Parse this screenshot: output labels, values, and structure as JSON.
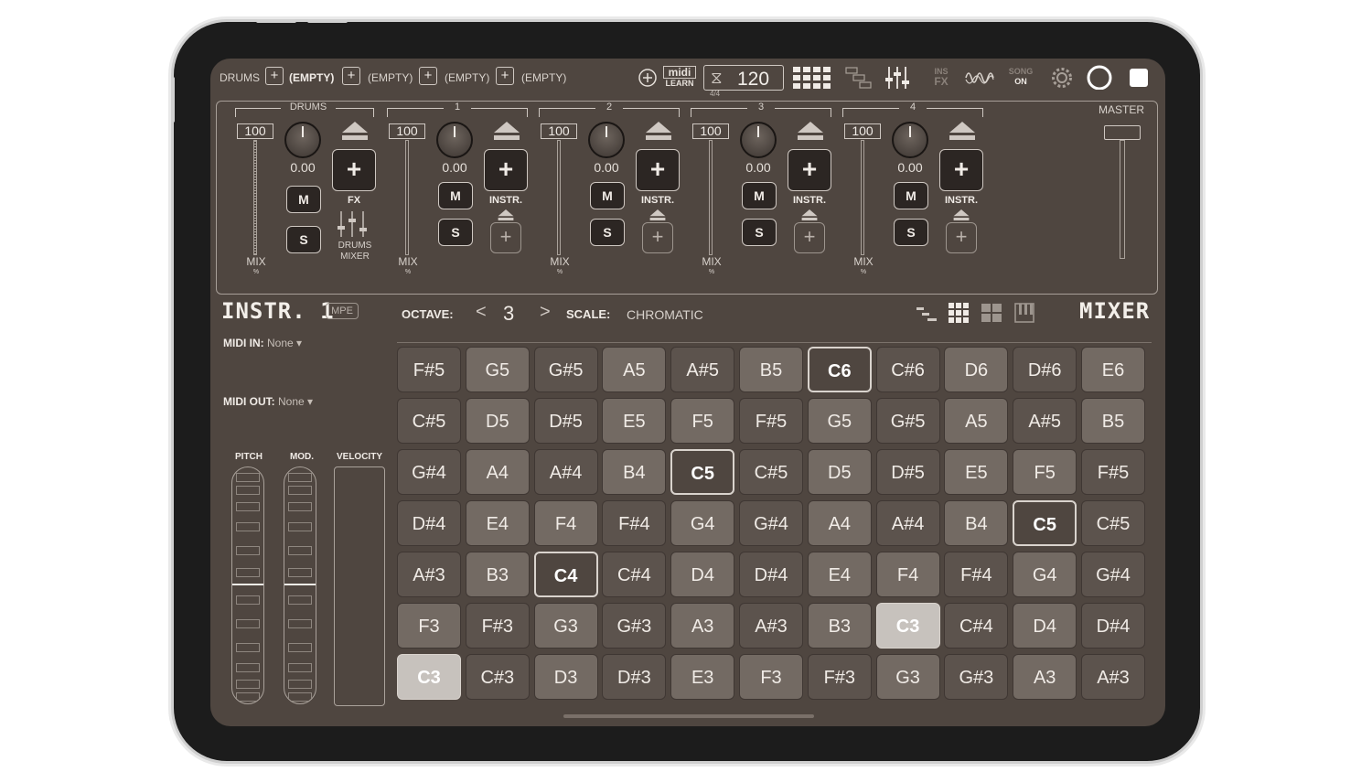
{
  "topbar": {
    "slots": [
      {
        "label": "DRUMS",
        "bold": false
      },
      {
        "label": "(EMPTY)",
        "bold": true
      },
      {
        "label": "(EMPTY)",
        "bold": false
      },
      {
        "label": "(EMPTY)",
        "bold": false
      },
      {
        "label": "(EMPTY)",
        "bold": false
      }
    ],
    "midi_learn_top": "midi",
    "midi_learn_bottom": "LEARN",
    "tempo": "120",
    "time_signature": "4/4",
    "ins_fx_top": "INS",
    "ins_fx_bottom": "FX",
    "song_top": "SONG",
    "song_bottom": "ON"
  },
  "mixer": {
    "channels": [
      {
        "name": "DRUMS",
        "volume": "100",
        "pan": "0.00",
        "mute": "M",
        "solo": "S",
        "add_label": "FX",
        "extra_label_1": "DRUMS",
        "extra_label_2": "MIXER",
        "mix_label": "MIX",
        "mix_unit": "%"
      },
      {
        "name": "1",
        "volume": "100",
        "pan": "0.00",
        "mute": "M",
        "solo": "S",
        "add_label": "INSTR.",
        "mix_label": "MIX",
        "mix_unit": "%"
      },
      {
        "name": "2",
        "volume": "100",
        "pan": "0.00",
        "mute": "M",
        "solo": "S",
        "add_label": "INSTR.",
        "mix_label": "MIX",
        "mix_unit": "%"
      },
      {
        "name": "3",
        "volume": "100",
        "pan": "0.00",
        "mute": "M",
        "solo": "S",
        "add_label": "INSTR.",
        "mix_label": "MIX",
        "mix_unit": "%"
      },
      {
        "name": "4",
        "volume": "100",
        "pan": "0.00",
        "mute": "M",
        "solo": "S",
        "add_label": "INSTR.",
        "mix_label": "MIX",
        "mix_unit": "%"
      }
    ],
    "master_label": "MASTER",
    "plus_glyph": "+"
  },
  "instrument": {
    "title": "INSTR. 1",
    "mpe_label": "MPE",
    "octave_label": "OCTAVE:",
    "octave_value": "3",
    "scale_label": "SCALE:",
    "scale_value": "CHROMATIC",
    "mixer_title": "MIXER",
    "prev_glyph": "<",
    "next_glyph": ">"
  },
  "controls": {
    "midi_in_label": "MIDI IN:",
    "midi_in_value": "None ▾",
    "midi_out_label": "MIDI OUT:",
    "midi_out_value": "None ▾",
    "pitch_label": "PITCH",
    "mod_label": "MOD.",
    "velocity_label": "VELOCITY"
  },
  "pads": [
    [
      {
        "note": "F#5",
        "shade": "light"
      },
      {
        "note": "G5",
        "shade": "mid"
      },
      {
        "note": "G#5",
        "shade": "light"
      },
      {
        "note": "A5",
        "shade": "mid"
      },
      {
        "note": "A#5",
        "shade": "light"
      },
      {
        "note": "B5",
        "shade": "mid"
      },
      {
        "note": "C6",
        "shade": "root"
      },
      {
        "note": "C#6",
        "shade": "light"
      },
      {
        "note": "D6",
        "shade": "mid"
      },
      {
        "note": "D#6",
        "shade": "light"
      },
      {
        "note": "E6",
        "shade": "mid"
      }
    ],
    [
      {
        "note": "C#5",
        "shade": "light"
      },
      {
        "note": "D5",
        "shade": "mid"
      },
      {
        "note": "D#5",
        "shade": "light"
      },
      {
        "note": "E5",
        "shade": "mid"
      },
      {
        "note": "F5",
        "shade": "mid"
      },
      {
        "note": "F#5",
        "shade": "light"
      },
      {
        "note": "G5",
        "shade": "mid"
      },
      {
        "note": "G#5",
        "shade": "light"
      },
      {
        "note": "A5",
        "shade": "mid"
      },
      {
        "note": "A#5",
        "shade": "light"
      },
      {
        "note": "B5",
        "shade": "mid"
      }
    ],
    [
      {
        "note": "G#4",
        "shade": "light"
      },
      {
        "note": "A4",
        "shade": "mid"
      },
      {
        "note": "A#4",
        "shade": "light"
      },
      {
        "note": "B4",
        "shade": "mid"
      },
      {
        "note": "C5",
        "shade": "root"
      },
      {
        "note": "C#5",
        "shade": "light"
      },
      {
        "note": "D5",
        "shade": "mid"
      },
      {
        "note": "D#5",
        "shade": "light"
      },
      {
        "note": "E5",
        "shade": "mid"
      },
      {
        "note": "F5",
        "shade": "mid"
      },
      {
        "note": "F#5",
        "shade": "light"
      }
    ],
    [
      {
        "note": "D#4",
        "shade": "light"
      },
      {
        "note": "E4",
        "shade": "mid"
      },
      {
        "note": "F4",
        "shade": "mid"
      },
      {
        "note": "F#4",
        "shade": "light"
      },
      {
        "note": "G4",
        "shade": "mid"
      },
      {
        "note": "G#4",
        "shade": "light"
      },
      {
        "note": "A4",
        "shade": "mid"
      },
      {
        "note": "A#4",
        "shade": "light"
      },
      {
        "note": "B4",
        "shade": "mid"
      },
      {
        "note": "C5",
        "shade": "root"
      },
      {
        "note": "C#5",
        "shade": "light"
      }
    ],
    [
      {
        "note": "A#3",
        "shade": "light"
      },
      {
        "note": "B3",
        "shade": "mid"
      },
      {
        "note": "C4",
        "shade": "root"
      },
      {
        "note": "C#4",
        "shade": "light"
      },
      {
        "note": "D4",
        "shade": "mid"
      },
      {
        "note": "D#4",
        "shade": "light"
      },
      {
        "note": "E4",
        "shade": "mid"
      },
      {
        "note": "F4",
        "shade": "mid"
      },
      {
        "note": "F#4",
        "shade": "light"
      },
      {
        "note": "G4",
        "shade": "mid"
      },
      {
        "note": "G#4",
        "shade": "light"
      }
    ],
    [
      {
        "note": "F3",
        "shade": "mid"
      },
      {
        "note": "F#3",
        "shade": "light"
      },
      {
        "note": "G3",
        "shade": "mid"
      },
      {
        "note": "G#3",
        "shade": "light"
      },
      {
        "note": "A3",
        "shade": "mid"
      },
      {
        "note": "A#3",
        "shade": "light"
      },
      {
        "note": "B3",
        "shade": "mid"
      },
      {
        "note": "C3",
        "shade": "active"
      },
      {
        "note": "C#4",
        "shade": "light"
      },
      {
        "note": "D4",
        "shade": "mid"
      },
      {
        "note": "D#4",
        "shade": "light"
      }
    ],
    [
      {
        "note": "C3",
        "shade": "active"
      },
      {
        "note": "C#3",
        "shade": "light"
      },
      {
        "note": "D3",
        "shade": "mid"
      },
      {
        "note": "D#3",
        "shade": "light"
      },
      {
        "note": "E3",
        "shade": "mid"
      },
      {
        "note": "F3",
        "shade": "mid"
      },
      {
        "note": "F#3",
        "shade": "light"
      },
      {
        "note": "G3",
        "shade": "mid"
      },
      {
        "note": "G#3",
        "shade": "light"
      },
      {
        "note": "A3",
        "shade": "mid"
      },
      {
        "note": "A#3",
        "shade": "light"
      }
    ]
  ],
  "colors": {
    "screen_bg": "#4f4640",
    "pad_light": "#5c534d",
    "pad_mid": "#736a63",
    "pad_active": "#c7c2bd",
    "text": "#f0ebe6"
  }
}
